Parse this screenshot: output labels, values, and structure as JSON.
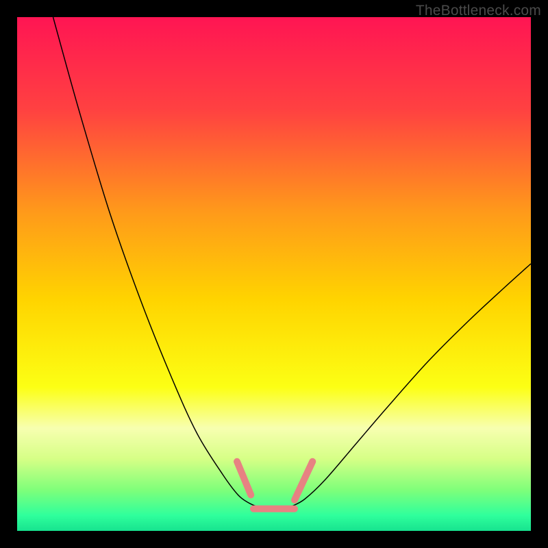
{
  "watermark": "TheBottleneck.com",
  "chart_data": {
    "type": "line",
    "title": "",
    "xlabel": "",
    "ylabel": "",
    "xlim": [
      0,
      100
    ],
    "ylim": [
      0,
      100
    ],
    "gradient_bg": {
      "stops": [
        {
          "offset": 0.0,
          "color": "#ff1553"
        },
        {
          "offset": 0.18,
          "color": "#ff4141"
        },
        {
          "offset": 0.38,
          "color": "#ff9a1a"
        },
        {
          "offset": 0.55,
          "color": "#ffd400"
        },
        {
          "offset": 0.72,
          "color": "#fcff14"
        },
        {
          "offset": 0.8,
          "color": "#f7ffb0"
        },
        {
          "offset": 0.86,
          "color": "#d6ff86"
        },
        {
          "offset": 0.92,
          "color": "#7fff7a"
        },
        {
          "offset": 0.97,
          "color": "#2fff9c"
        },
        {
          "offset": 1.0,
          "color": "#17e38f"
        }
      ]
    },
    "series": [
      {
        "name": "left-curve",
        "stroke": "#000000",
        "width": 1.5,
        "points": [
          {
            "x": 7,
            "y": 100
          },
          {
            "x": 12,
            "y": 82
          },
          {
            "x": 18,
            "y": 62
          },
          {
            "x": 24,
            "y": 45
          },
          {
            "x": 30,
            "y": 30
          },
          {
            "x": 35,
            "y": 19
          },
          {
            "x": 40,
            "y": 11
          },
          {
            "x": 43,
            "y": 7
          },
          {
            "x": 45,
            "y": 5.5
          },
          {
            "x": 46.5,
            "y": 4.8
          }
        ]
      },
      {
        "name": "right-curve",
        "stroke": "#000000",
        "width": 1.5,
        "points": [
          {
            "x": 53.5,
            "y": 4.8
          },
          {
            "x": 56,
            "y": 6.2
          },
          {
            "x": 60,
            "y": 10
          },
          {
            "x": 66,
            "y": 17
          },
          {
            "x": 72,
            "y": 24
          },
          {
            "x": 80,
            "y": 33
          },
          {
            "x": 88,
            "y": 41
          },
          {
            "x": 95,
            "y": 47.5
          },
          {
            "x": 100,
            "y": 52
          }
        ]
      },
      {
        "name": "bottom-connector",
        "stroke": "#000000",
        "width": 1.5,
        "points": [
          {
            "x": 46.5,
            "y": 4.8
          },
          {
            "x": 48,
            "y": 4.2
          },
          {
            "x": 50,
            "y": 4.0
          },
          {
            "x": 52,
            "y": 4.2
          },
          {
            "x": 53.5,
            "y": 4.8
          }
        ]
      },
      {
        "name": "pink-overlay-left",
        "stroke": "#e78282",
        "width": 10,
        "cap": "round",
        "points": [
          {
            "x": 42.8,
            "y": 13.5
          },
          {
            "x": 45.5,
            "y": 7
          }
        ]
      },
      {
        "name": "pink-overlay-bottom",
        "stroke": "#e78282",
        "width": 10,
        "cap": "round",
        "points": [
          {
            "x": 46,
            "y": 4.3
          },
          {
            "x": 54,
            "y": 4.3
          }
        ]
      },
      {
        "name": "pink-overlay-right",
        "stroke": "#e78282",
        "width": 10,
        "cap": "round",
        "points": [
          {
            "x": 54,
            "y": 6
          },
          {
            "x": 57.5,
            "y": 13.5
          }
        ]
      }
    ]
  }
}
